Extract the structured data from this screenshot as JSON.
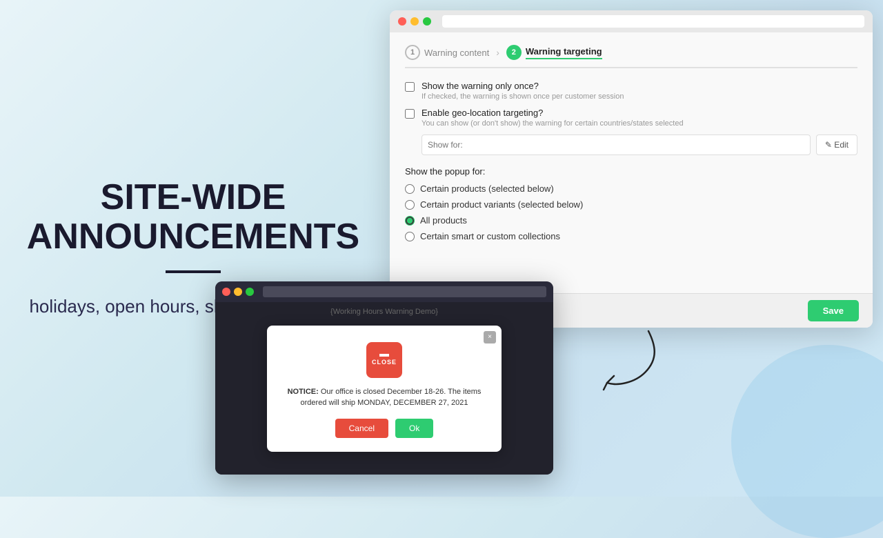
{
  "left": {
    "headline_line1": "SITE-WIDE",
    "headline_line2": "ANNOUNCEMENTS",
    "subtext": "holidays, open hours, shipping delay, etc."
  },
  "browser_main": {
    "step1_label": "Warning content",
    "step2_label": "Warning targeting",
    "checkbox1_label": "Show the warning only once?",
    "checkbox1_hint": "If checked, the warning is shown once per customer session",
    "checkbox2_label": "Enable geo-location targeting?",
    "checkbox2_hint": "You can show (or don't show) the warning for certain countries/states selected",
    "show_for_placeholder": "Show for:",
    "edit_label": "✎ Edit",
    "show_popup_label": "Show the popup for:",
    "radio_options": [
      "Certain products (selected below)",
      "Certain product variants (selected below)",
      "All products",
      "Certain smart or custom collections"
    ],
    "save_label": "Save"
  },
  "browser_demo": {
    "title": "{Working Hours Warning Demo}",
    "modal_notice_prefix": "NOTICE:",
    "modal_notice_text": " Our office is closed December 18-26. The items ordered will ship MONDAY, DECEMBER 27, 2021",
    "modal_cancel": "Cancel",
    "modal_ok": "Ok",
    "close_label": "CLOSE"
  }
}
